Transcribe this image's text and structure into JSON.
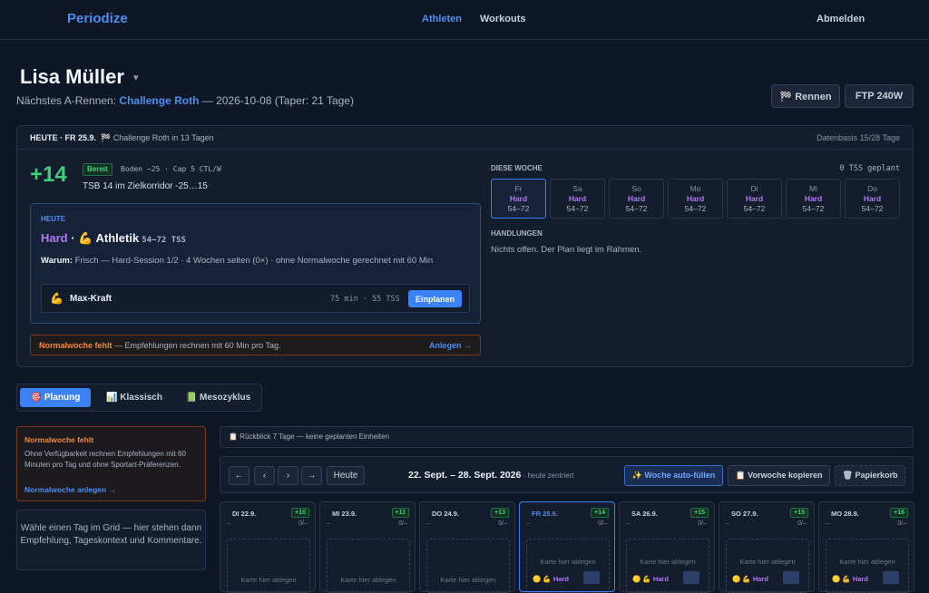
{
  "nav": {
    "brand": "Periodize",
    "links": [
      "Athleten",
      "Workouts"
    ],
    "logout": "Abmelden"
  },
  "header": {
    "athlete": "Lisa Müller",
    "race_prefix": "Nächstes A-Rennen: ",
    "race_name": "Challenge Roth",
    "race_suffix": " — 2026-10-08 (Taper: 21 Tage)",
    "btn_races": "🏁 Rennen",
    "btn_ftp": "FTP 240W"
  },
  "today": {
    "label": "HEUTE · FR 25.9.",
    "countdown": "🏁 Challenge Roth in 13 Tagen",
    "datenbasis": "Datenbasis 15/28 Tage",
    "tsb": "+14",
    "status": "Bereit",
    "meta": "Boden −25 · Cap 5 CTL/W",
    "desc": "TSB 14 im Zielkorridor -25…15",
    "card": {
      "label": "HEUTE",
      "intensity": "Hard",
      "sep": " · ",
      "session": "💪 Athletik",
      "tss": "54–72 TSS",
      "why_label": "Warum:",
      "why": " Frisch — Hard-Session 1/2 · 4 Wochen selten (0×) · ohne Normalwoche gerechnet mit 60 Min",
      "workout_icon": "💪",
      "workout_name": "Max-Kraft",
      "workout_meta": "75 min · 55 TSS",
      "workout_btn": "Einplanen"
    },
    "warn_title": "Normalwoche fehlt",
    "warn_text": " — Empfehlungen rechnen mit 60 Min pro Tag.",
    "warn_link": "Anlegen →",
    "week_label": "DIESE WOCHE",
    "week_tss": "0 TSS geplant",
    "week_days": [
      {
        "name": "Fr",
        "level": "Hard",
        "range": "54–72"
      },
      {
        "name": "Sa",
        "level": "Hard",
        "range": "54–72"
      },
      {
        "name": "So",
        "level": "Hard",
        "range": "54–72"
      },
      {
        "name": "Mo",
        "level": "Hard",
        "range": "54–72"
      },
      {
        "name": "Di",
        "level": "Hard",
        "range": "54–72"
      },
      {
        "name": "Mi",
        "level": "Hard",
        "range": "54–72"
      },
      {
        "name": "Do",
        "level": "Hard",
        "range": "54–72"
      }
    ],
    "actions_label": "HANDLUNGEN",
    "actions_text": "Nichts offen. Der Plan liegt im Rahmen."
  },
  "tabs": [
    "🎯 Planung",
    "📊 Klassisch",
    "📗 Mesozyklus"
  ],
  "sidebar": {
    "warn_title": "Normalwoche fehlt",
    "warn_text": "Ohne Verfügbarkeit rechnen Empfehlungen mit 60 Minuten pro Tag und ohne Sportart-Präferenzen.",
    "warn_link": "Normalwoche anlegen →",
    "hint": "Wähle einen Tag im Grid — hier stehen dann Empfehlung, Tageskontext und Kommentare."
  },
  "planner": {
    "rueckblick": "📋 Rückblick 7 Tage — keine geplanten Einheiten",
    "nav": [
      "←",
      "‹",
      "›",
      "→",
      "Heute"
    ],
    "range": "22. Sept. – 28. Sept. 2026",
    "range_sub": " · heute zentriert",
    "btn_auto": "✨ Woche auto-füllen",
    "btn_copy": "📋 Vorwoche kopieren",
    "btn_trash": "🗑 Papierkorb",
    "drop_text": "Karte hier ablegen",
    "days": [
      {
        "name": "DI 22.9.",
        "tsb": "+10",
        "dash": "–",
        "count": "0/–",
        "chip": ""
      },
      {
        "name": "MI 23.9.",
        "tsb": "+11",
        "dash": "–",
        "count": "0/–",
        "chip": ""
      },
      {
        "name": "DO 24.9.",
        "tsb": "+13",
        "dash": "–",
        "count": "0/–",
        "chip": ""
      },
      {
        "name": "FR 25.9.",
        "tsb": "+14",
        "dash": "–",
        "count": "0/–",
        "chip": "🟡 💪 Hard"
      },
      {
        "name": "SA 26.9.",
        "tsb": "+15",
        "dash": "–",
        "count": "0/–",
        "chip": "🟡 💪 Hard"
      },
      {
        "name": "SO 27.9.",
        "tsb": "+15",
        "dash": "–",
        "count": "0/–",
        "chip": "🟡 💪 Hard"
      },
      {
        "name": "MO 28.9.",
        "tsb": "+16",
        "dash": "–",
        "count": "0/–",
        "chip": "🟡 💪 Hard"
      }
    ]
  },
  "colors": {
    "accent": "#3b82f6",
    "good": "#3ecf7a",
    "warn": "#f08a3c",
    "hard": "#b07af0",
    "bg": "#0f1626"
  }
}
